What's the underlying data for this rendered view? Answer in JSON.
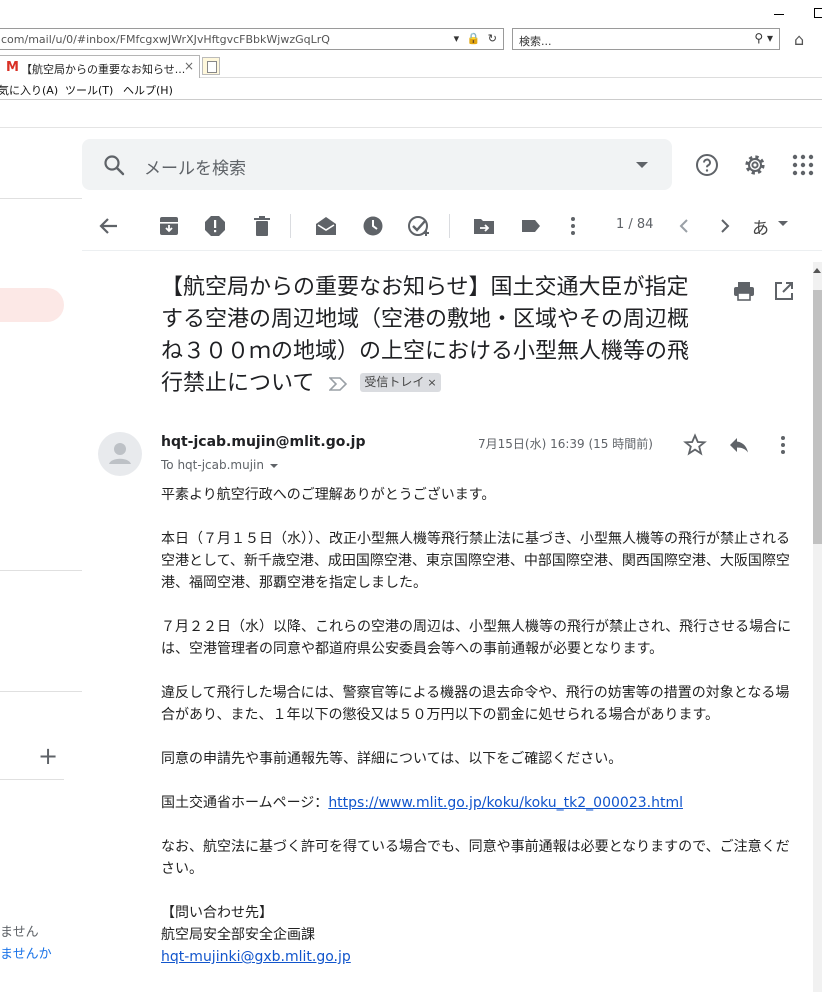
{
  "browser": {
    "address_url": "com/mail/u/0/#inbox/FMfcgxwJWrXJvHftgvcFBbkWjwzGqLrQ",
    "address_controls": "▾ 🔒 ↻",
    "search_placeholder": "検索...",
    "search_controls": "⚲ ▾",
    "tab_title": "【航空局からの重要なお知らせ...",
    "tab_close": "×",
    "menu": [
      "気に入り(A)",
      "ツール(T)",
      "ヘルプ(H)"
    ]
  },
  "gmail": {
    "search_placeholder": "メールを検索",
    "pager": "1 / 84",
    "input_tool": "あ"
  },
  "message": {
    "subject": "【航空局からの重要なお知らせ】国土交通大臣が指定する空港の周辺地域（空港の敷地・区域やその周辺概ね３００ｍの地域）の上空における小型無人機等の飛行禁止について",
    "label": "受信トレイ",
    "label_close": "×",
    "sender": "hqt-jcab.mujin@mlit.go.jp",
    "to": "To hqt-jcab.mujin",
    "date": "7月15日(水) 16:39 (15 時間前)",
    "body": {
      "p1": "平素より航空行政へのご理解ありがとうございます。",
      "p2": "本日（７月１５日（水））、改正小型無人機等飛行禁止法に基づき、小型無人機等の飛行が禁止される空港として、新千歳空港、成田国際空港、東京国際空港、中部国際空港、関西国際空港、大阪国際空港、福岡空港、那覇空港を指定しました。",
      "p3": "７月２２日（水）以降、これらの空港の周辺は、小型無人機等の飛行が禁止され、飛行させる場合には、空港管理者の同意や都道府県公安委員会等への事前通報が必要となります。",
      "p4": "違反して飛行した場合には、警察官等による機器の退去命令や、飛行の妨害等の措置の対象となる場合があり、また、１年以下の懲役又は５０万円以下の罰金に処せられる場合があります。",
      "p5": "同意の申請先や事前通報先等、詳細については、以下をご確認ください。",
      "p6_prefix": "国土交通省ホームページ：",
      "p6_link": "https://www.mlit.go.jp/koku/koku_tk2_000023.html",
      "p7": "なお、航空法に基づく許可を得ている場合でも、同意や事前通報は必要となりますので、ご注意ください。",
      "contact_heading": "【問い合わせ先】",
      "contact_dept": "航空局安全部安全企画課",
      "contact_email": "hqt-mujinki@gxb.mlit.go.jp"
    }
  },
  "sidebar": {
    "text1": "ません",
    "text2": "ませんか",
    "plus": "+"
  },
  "colors": {
    "accent": "#1a73e8",
    "link": "#1155cc",
    "icon": "#5f6368",
    "gmail_red": "#d93025"
  }
}
